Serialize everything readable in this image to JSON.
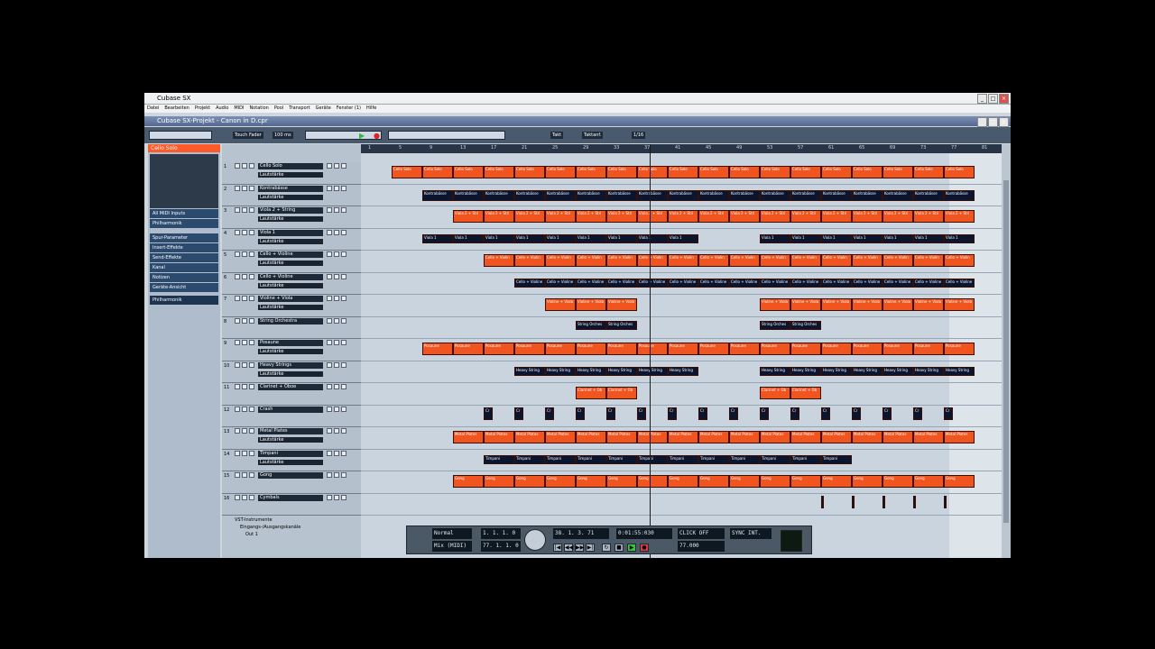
{
  "window": {
    "title": "Cubase SX",
    "project_title": "Cubase SX-Projekt - Canon in D.cpr"
  },
  "menu": [
    "Datei",
    "Bearbeiten",
    "Projekt",
    "Audio",
    "MIDI",
    "Notation",
    "Pool",
    "Transport",
    "Geräte",
    "Fenster (1)",
    "Hilfe"
  ],
  "toolbar": {
    "automation_mode": "Touch Fader",
    "zoom": "100 ms",
    "snap_1": "Takt",
    "snap_2": "Taktanf.",
    "quantize": "1/16"
  },
  "inspector": {
    "header": "Cello Solo",
    "input": "All MIDI Inputs",
    "output": "Philharmonik",
    "sections": [
      "Spur-Parameter",
      "Insert-Effekte",
      "Send-Effekte",
      "Kanal",
      "Notizen",
      "Geräte-Ansicht"
    ],
    "orchestra": "Philharmonik"
  },
  "ruler": [
    "1",
    "5",
    "9",
    "13",
    "17",
    "21",
    "25",
    "29",
    "33",
    "37",
    "41",
    "45",
    "49",
    "53",
    "57",
    "61",
    "65",
    "69",
    "73",
    "77",
    "81"
  ],
  "tracks": [
    {
      "num": "1",
      "name": "Cello Solo",
      "sub": "Lautstärke",
      "lane_label": "Cello Solo"
    },
    {
      "num": "2",
      "name": "Kontrabässe",
      "sub": "Lautstärke",
      "lane_label": "Kontrabässe"
    },
    {
      "num": "3",
      "name": "Viola 2 + String",
      "sub": "Lautstärke",
      "lane_label": "Viola 2 + Stri"
    },
    {
      "num": "4",
      "name": "Viola 1",
      "sub": "Lautstärke",
      "lane_label": "Viola 1"
    },
    {
      "num": "5",
      "name": "Cello + Violine",
      "sub": "Lautstärke",
      "lane_label": "Cello + Violin"
    },
    {
      "num": "6",
      "name": "Cello + Violine",
      "sub": "Lautstärke",
      "lane_label": "Cello + Violine"
    },
    {
      "num": "7",
      "name": "Violine + Viola",
      "sub": "Lautstärke",
      "lane_label": "Violine + Viola"
    },
    {
      "num": "8",
      "name": "String Orchestra",
      "sub": "",
      "lane_label": "String Orches"
    },
    {
      "num": "9",
      "name": "Posaune",
      "sub": "Lautstärke",
      "lane_label": "Posaune"
    },
    {
      "num": "10",
      "name": "Heavy Strings",
      "sub": "Lautstärke",
      "lane_label": "Heavy String"
    },
    {
      "num": "11",
      "name": "Clarinet + Oboe",
      "sub": "",
      "lane_label": "Clarinet + Ob"
    },
    {
      "num": "12",
      "name": "Crash",
      "sub": "",
      "lane_label": "Cr"
    },
    {
      "num": "13",
      "name": "Metal Plates",
      "sub": "Lautstärke",
      "lane_label": "Metal Plates"
    },
    {
      "num": "14",
      "name": "Timpani",
      "sub": "Lautstärke",
      "lane_label": "Timpani"
    },
    {
      "num": "15",
      "name": "Gong",
      "sub": "",
      "lane_label": "Gong"
    },
    {
      "num": "16",
      "name": "Cymbals",
      "sub": "",
      "lane_label": ""
    }
  ],
  "folders": [
    "VST-Instrumente",
    "Eingangs-/Ausgangskanäle",
    "Out 1"
  ],
  "transport": {
    "mode_1": "Normal",
    "mode_2": "Mix (MIDI)",
    "left_locator": "1. 1. 1. 0",
    "right_locator": "77. 1. 1. 0",
    "position_bars": "38. 1. 3. 71",
    "position_time": "0:01:55:030",
    "click": "CLICK OFF",
    "tempo": "77.000",
    "sync": "SYNC INT."
  }
}
